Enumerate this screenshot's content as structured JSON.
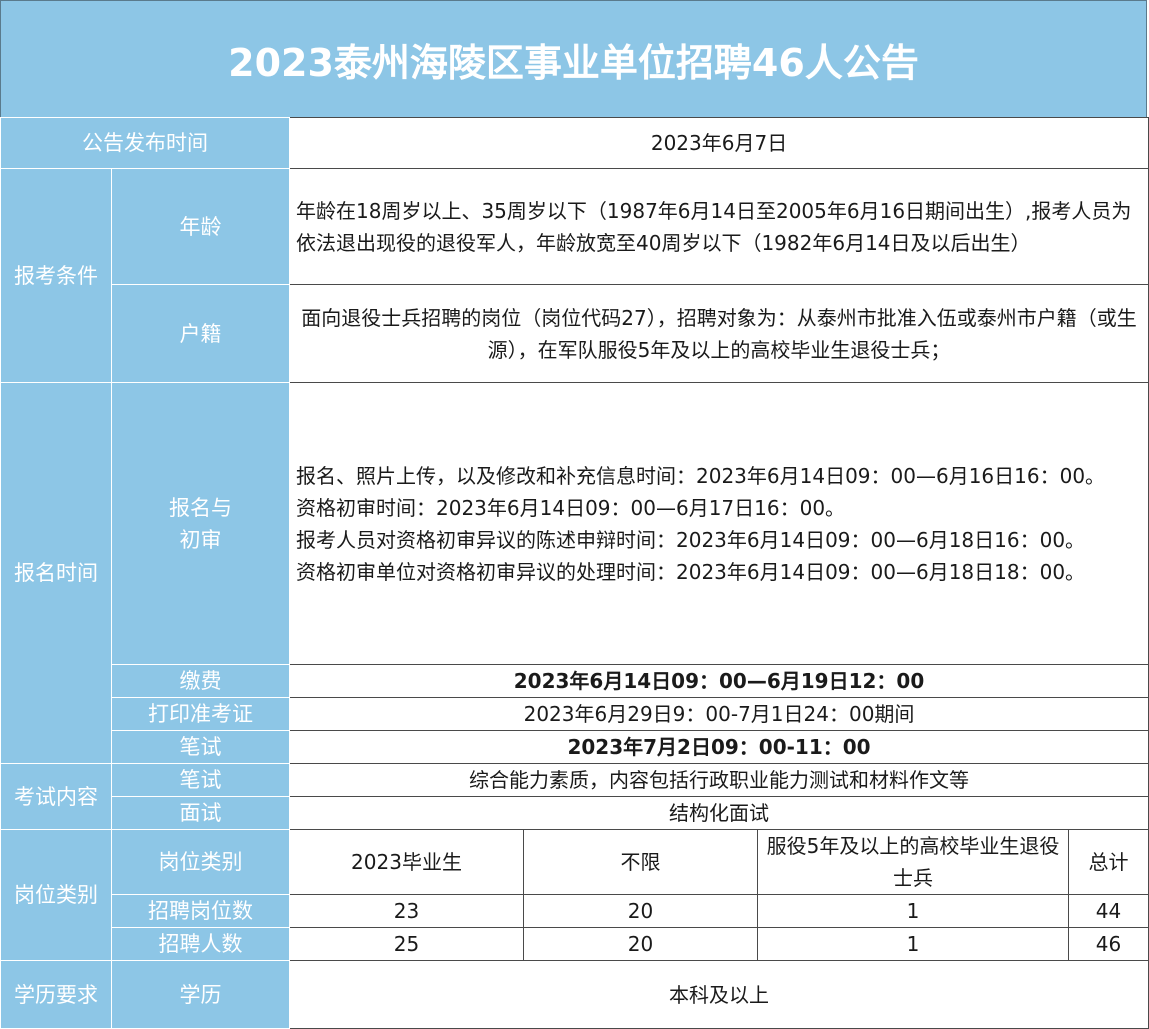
{
  "title": "2023泰州海陵区事业单位招聘46人公告",
  "rows": {
    "publish": {
      "label": "公告发布时间",
      "value": "2023年6月7日"
    },
    "conditions": {
      "label": "报考条件",
      "age": {
        "label": "年龄",
        "value": "年龄在18周岁以上、35周岁以下（1987年6月14日至2005年6月16日期间出生）,报考人员为依法退出现役的退役军人，年龄放宽至40周岁以下（1982年6月14日及以后出生）"
      },
      "huji": {
        "label": "户籍",
        "value": "面向退役士兵招聘的岗位（岗位代码27），招聘对象为：从泰州市批准入伍或泰州市户籍（或生源），在军队服役5年及以上的高校毕业生退役士兵；"
      }
    },
    "signup": {
      "label": "报名时间",
      "register": {
        "label_line1": "报名与",
        "label_line2": "初审",
        "lines": [
          "报名、照片上传，以及修改和补充信息时间：2023年6月14日09：00—6月16日16：00。",
          "资格初审时间：2023年6月14日09：00—6月17日16：00。",
          "报考人员对资格初审异议的陈述申辩时间：2023年6月14日09：00—6月18日16：00。",
          "资格初审单位对资格初审异议的处理时间：2023年6月14日09：00—6月18日18：00。"
        ]
      },
      "fee": {
        "label": "缴费",
        "value": "2023年6月14日09：00—6月19日12：00"
      },
      "print": {
        "label": "打印准考证",
        "value": "2023年6月29日9：00-7月1日24：00期间"
      },
      "written": {
        "label": "笔试",
        "value": "2023年7月2日09：00-11：00"
      }
    },
    "content": {
      "label": "考试内容",
      "written": {
        "label": "笔试",
        "value": "综合能力素质，内容包括行政职业能力测试和材料作文等"
      },
      "interview": {
        "label": "面试",
        "value": "结构化面试"
      }
    },
    "posts": {
      "label": "岗位类别",
      "category_label": "岗位类别",
      "columns": [
        "2023毕业生",
        "不限",
        "服役5年及以上的高校毕业生退役士兵",
        "总计"
      ],
      "count_label": "招聘岗位数",
      "counts": [
        "23",
        "20",
        "1",
        "44"
      ],
      "people_label": "招聘人数",
      "people": [
        "25",
        "20",
        "1",
        "46"
      ]
    },
    "education": {
      "label": "学历要求",
      "sub_label": "学历",
      "value": "本科及以上"
    }
  }
}
